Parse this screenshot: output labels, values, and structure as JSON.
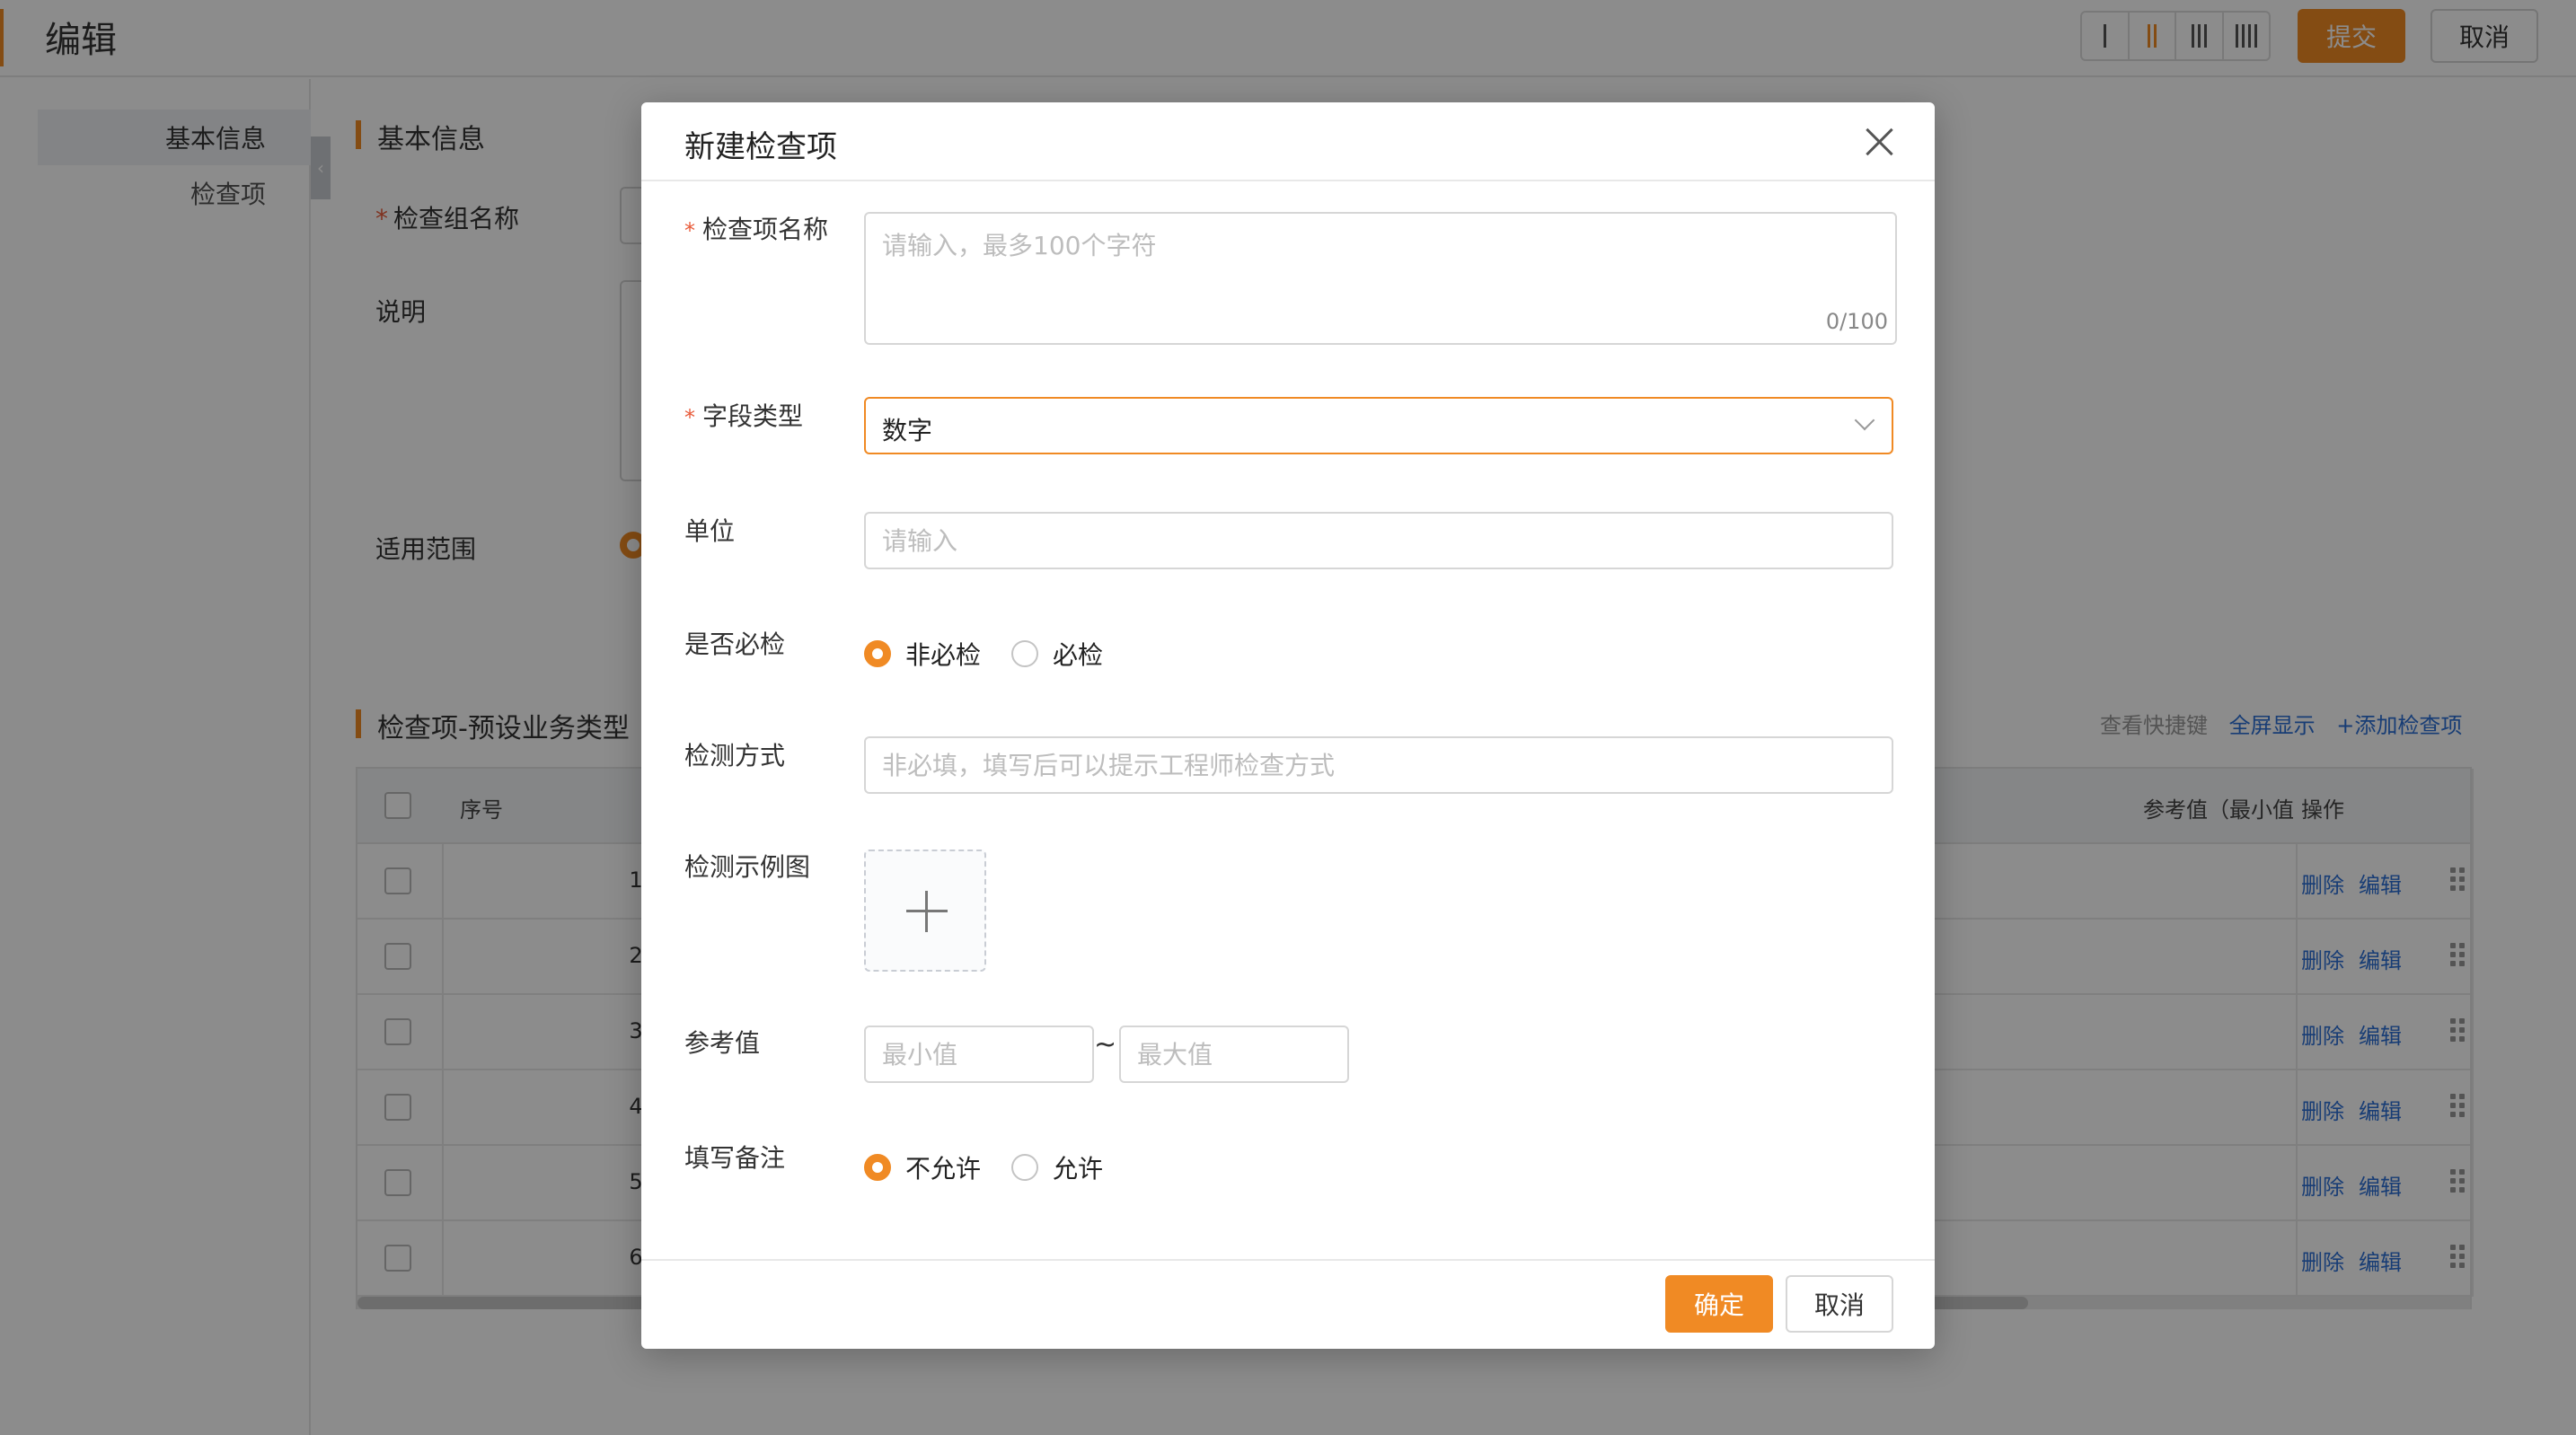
{
  "page": {
    "title": "编辑",
    "submit_label": "提交",
    "cancel_label": "取消",
    "layout_options": [
      "1-column",
      "2-column",
      "3-column",
      "4-column"
    ],
    "layout_selected": "2-column"
  },
  "sidebar": {
    "items": [
      {
        "label": "基本信息",
        "active": true
      },
      {
        "label": "检查项",
        "active": false
      }
    ]
  },
  "basic_info": {
    "section_title": "基本信息",
    "group_name_label": "检查组名称",
    "description_label": "说明",
    "scope_label": "适用范围"
  },
  "check_items": {
    "section_title": "检查项-预设业务类型",
    "shortcut_link": "查看快捷键",
    "fullscreen_link": "全屏显示",
    "add_link": "+添加检查项",
    "columns": {
      "index": "序号",
      "reference": "参考值（最小值",
      "actions": "操作"
    },
    "rows": [
      {
        "index": "1"
      },
      {
        "index": "2"
      },
      {
        "index": "3"
      },
      {
        "index": "4"
      },
      {
        "index": "5"
      },
      {
        "index": "6"
      }
    ],
    "delete_label": "删除",
    "edit_label": "编辑"
  },
  "modal": {
    "title": "新建检查项",
    "name": {
      "label": "检查项名称",
      "placeholder": "请输入，最多100个字符",
      "counter": "0/100"
    },
    "field_type": {
      "label": "字段类型",
      "value": "数字"
    },
    "unit": {
      "label": "单位",
      "placeholder": "请输入"
    },
    "required": {
      "label": "是否必检",
      "options": [
        "非必检",
        "必检"
      ],
      "selected": "非必检"
    },
    "method": {
      "label": "检测方式",
      "placeholder": "非必填，填写后可以提示工程师检查方式"
    },
    "example_image": {
      "label": "检测示例图"
    },
    "reference": {
      "label": "参考值",
      "min_placeholder": "最小值",
      "separator": "~",
      "max_placeholder": "最大值"
    },
    "note": {
      "label": "填写备注",
      "options": [
        "不允许",
        "允许"
      ],
      "selected": "不允许"
    },
    "ok_label": "确定",
    "cancel_label": "取消"
  },
  "colors": {
    "accent": "#f08a24",
    "link": "#2d6fd6",
    "required_star": "#e85b3a"
  }
}
